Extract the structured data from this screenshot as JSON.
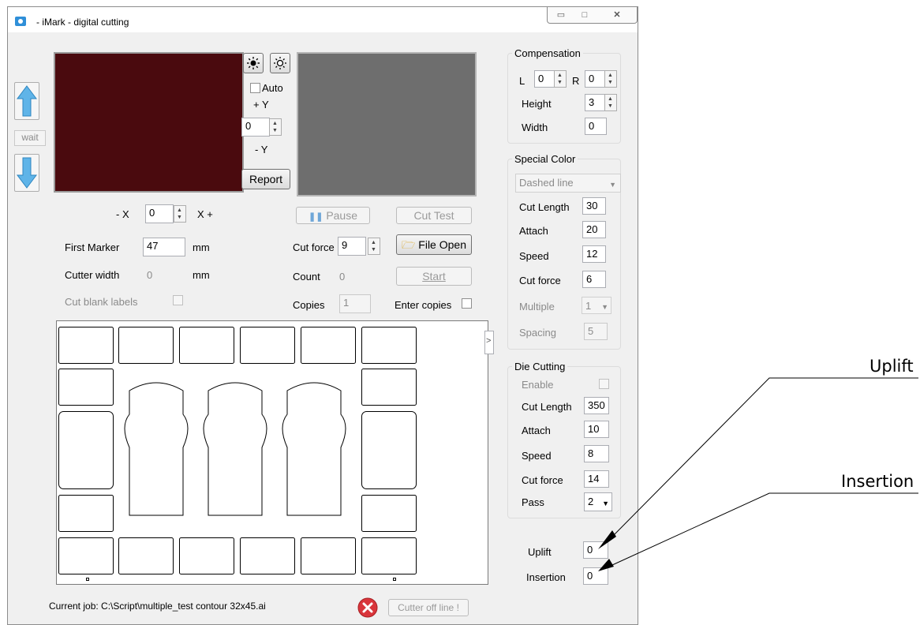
{
  "window": {
    "title": "- iMark - digital cutting",
    "minimize": "▭",
    "maximize": "□",
    "close": "✕"
  },
  "camera": {
    "wait_label": "wait",
    "auto_label": "Auto",
    "plus_y": "+ Y",
    "minus_y": "- Y",
    "y_value": "0",
    "report_label": "Report",
    "minus_x": "- X",
    "plus_x": "X +",
    "x_value": "0"
  },
  "params": {
    "first_marker_label": "First Marker",
    "first_marker_value": "47",
    "first_marker_unit": "mm",
    "cutter_width_label": "Cutter width",
    "cutter_width_value": "0",
    "cutter_width_unit": "mm",
    "cut_blank_label": "Cut blank labels"
  },
  "job": {
    "pause_label": "Pause",
    "cut_test_label": "Cut Test",
    "cut_force_label": "Cut force",
    "cut_force_value": "9",
    "file_open_label": "File Open",
    "count_label": "Count",
    "count_value": "0",
    "start_label": "Start",
    "copies_label": "Copies",
    "copies_value": "1",
    "enter_copies_label": "Enter copies",
    "current_job": "Current job: C:\\Script\\multiple_test contour 32x45.ai",
    "cutter_status": "Cutter off line !",
    "expand_label": ">"
  },
  "compensation": {
    "title": "Compensation",
    "l_label": "L",
    "l_value": "0",
    "r_label": "R",
    "r_value": "0",
    "height_label": "Height",
    "height_value": "3",
    "width_label": "Width",
    "width_value": "0"
  },
  "special_color": {
    "title": "Special Color",
    "line_type": "Dashed line",
    "cut_length_label": "Cut Length",
    "cut_length_value": "30",
    "attach_label": "Attach",
    "attach_value": "20",
    "speed_label": "Speed",
    "speed_value": "12",
    "cut_force_label": "Cut force",
    "cut_force_value": "6",
    "multiple_label": "Multiple",
    "multiple_value": "1",
    "spacing_label": "Spacing",
    "spacing_value": "5"
  },
  "die_cutting": {
    "title": "Die Cutting",
    "enable_label": "Enable",
    "cut_length_label": "Cut Length",
    "cut_length_value": "350",
    "attach_label": "Attach",
    "attach_value": "10",
    "speed_label": "Speed",
    "speed_value": "8",
    "cut_force_label": "Cut force",
    "cut_force_value": "14",
    "pass_label": "Pass",
    "pass_value": "2"
  },
  "bottom_right": {
    "uplift_label": "Uplift",
    "uplift_value": "0",
    "insertion_label": "Insertion",
    "insertion_value": "0"
  },
  "callouts": {
    "uplift": "Uplift",
    "insertion": "Insertion"
  },
  "colors": {
    "camera_left": "#4a0a0e",
    "camera_right": "#6e6e6e",
    "arrow": "#5fb4e8",
    "error_red": "#d9353b"
  },
  "icons": [
    "sun-icon",
    "sun-outline-icon",
    "arrow-up-icon",
    "arrow-down-icon",
    "pause-icon",
    "folder-icon",
    "error-icon"
  ]
}
